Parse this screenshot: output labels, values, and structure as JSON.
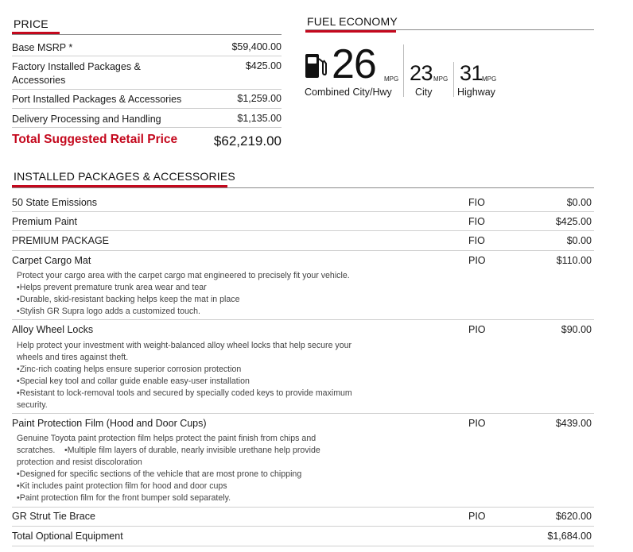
{
  "price": {
    "title": "PRICE",
    "rows": [
      {
        "label": "Base MSRP *",
        "value": "$59,400.00"
      },
      {
        "label": "Factory Installed Packages & Accessories",
        "value": "$425.00"
      },
      {
        "label": "Port Installed Packages & Accessories",
        "value": "$1,259.00"
      },
      {
        "label": "Delivery Processing and Handling",
        "value": "$1,135.00"
      }
    ],
    "total_label": "Total Suggested Retail Price",
    "total_value": "$62,219.00"
  },
  "fuel": {
    "title": "FUEL ECONOMY",
    "combined": {
      "value": "26",
      "unit": "MPG",
      "label": "Combined City/Hwy"
    },
    "city": {
      "value": "23",
      "unit": "MPG",
      "label": "City"
    },
    "highway": {
      "value": "31",
      "unit": "MPG",
      "label": "Highway"
    },
    "icon": "fuel-pump-icon"
  },
  "packages": {
    "title": "INSTALLED PACKAGES & ACCESSORIES",
    "items": [
      {
        "name": "50 State Emissions",
        "code": "FIO",
        "price": "$0.00",
        "desc": []
      },
      {
        "name": "Premium Paint",
        "code": "FIO",
        "price": "$425.00",
        "desc": []
      },
      {
        "name": "PREMIUM PACKAGE",
        "code": "FIO",
        "price": "$0.00",
        "desc": []
      },
      {
        "name": "Carpet Cargo Mat",
        "code": "PIO",
        "price": "$110.00",
        "desc": [
          "Protect your cargo area with the carpet cargo mat engineered to precisely fit your vehicle.",
          "•Helps prevent premature trunk area wear and tear",
          "•Durable, skid-resistant backing helps keep the mat in place",
          "•Stylish GR Supra logo adds a customized touch."
        ]
      },
      {
        "name": "Alloy Wheel Locks",
        "code": "PIO",
        "price": "$90.00",
        "desc": [
          "Help protect your investment with weight-balanced alloy wheel locks that help secure your",
          "wheels and tires against theft.",
          "•Zinc-rich coating helps ensure superior corrosion protection",
          "•Special key tool and collar guide enable easy-user installation",
          "•Resistant to lock-removal tools and secured by specially coded keys to provide maximum",
          "security."
        ]
      },
      {
        "name": "Paint Protection Film (Hood and Door Cups)",
        "code": "PIO",
        "price": "$439.00",
        "desc": [
          "Genuine Toyota paint protection film helps protect  the paint finish from chips and",
          "scratches.    •Multiple film layers of durable, nearly invisible urethane help provide",
          "protection and resist discoloration",
          "•Designed for specific sections of the vehicle that are most prone to chipping",
          "•Kit includes paint protection film for hood and door cups",
          "•Paint protection film for the front bumper sold separately."
        ]
      },
      {
        "name": "GR Strut Tie Brace",
        "code": "PIO",
        "price": "$620.00",
        "desc": []
      }
    ],
    "total_label": "Total Optional Equipment",
    "total_value": "$1,684.00"
  },
  "colors": {
    "accent": "#c4081d"
  }
}
